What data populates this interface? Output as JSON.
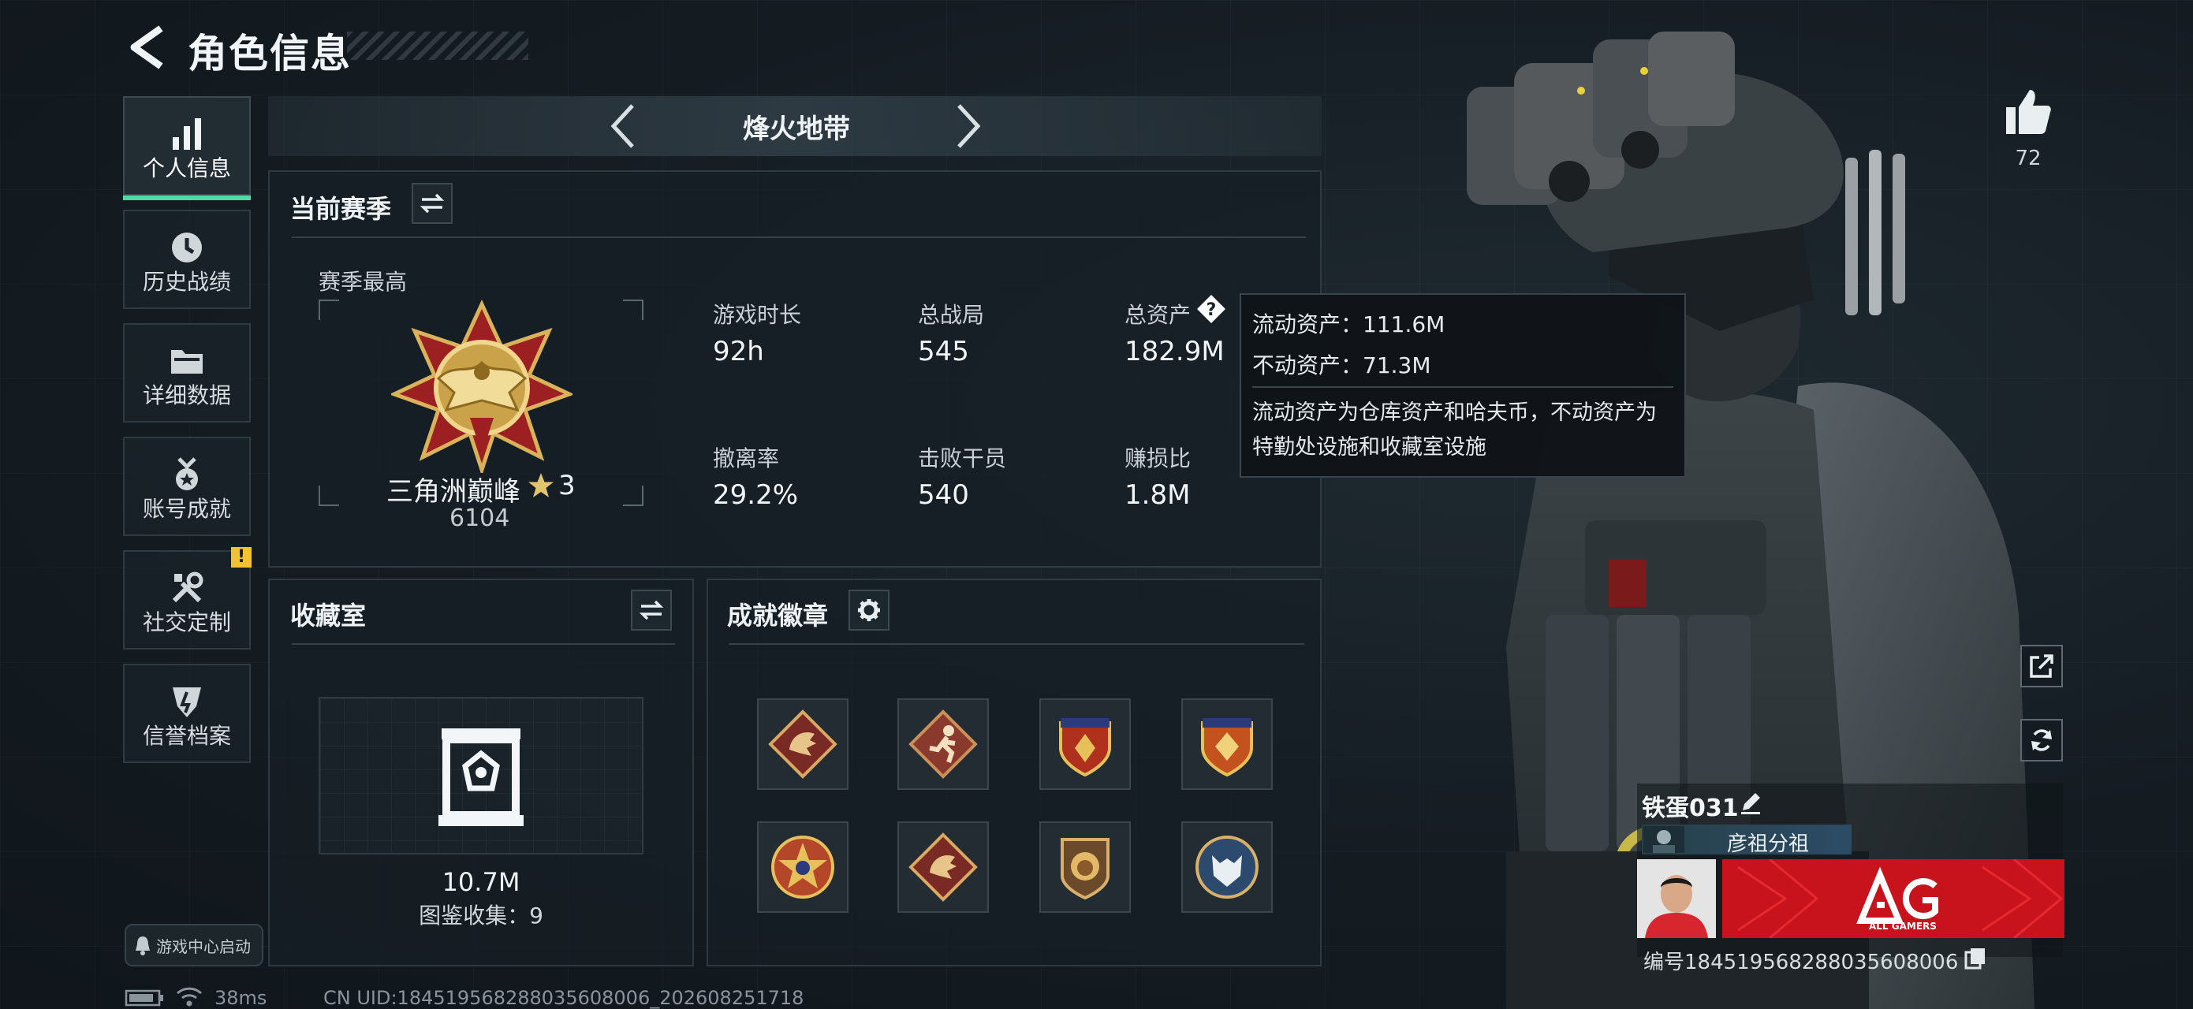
{
  "header": {
    "title": "角色信息"
  },
  "sidebar": {
    "items": [
      {
        "label": "个人信息",
        "icon": "chart-bars-icon",
        "active": true
      },
      {
        "label": "历史战绩",
        "icon": "clock-icon"
      },
      {
        "label": "详细数据",
        "icon": "folder-icon"
      },
      {
        "label": "账号成就",
        "icon": "medal-icon"
      },
      {
        "label": "社交定制",
        "icon": "tools-icon",
        "badge": "!"
      },
      {
        "label": "信誉档案",
        "icon": "shield-icon"
      }
    ],
    "launch_label": "游戏中心启动"
  },
  "mode": {
    "label": "烽火地带"
  },
  "season": {
    "title": "当前赛季",
    "best_label": "赛季最高",
    "rank_name": "三角洲巅峰",
    "rank_stars": "3",
    "rank_score": "6104",
    "stats": [
      {
        "label": "游戏时长",
        "value": "92h"
      },
      {
        "label": "总战局",
        "value": "545"
      },
      {
        "label": "总资产",
        "value": "182.9M"
      },
      {
        "label": "撤离率",
        "value": "29.2%"
      },
      {
        "label": "击败干员",
        "value": "540"
      },
      {
        "label": "赚损比",
        "value": "1.8M"
      }
    ],
    "help_glyph": "?"
  },
  "tooltip": {
    "liquid": "流动资产：111.6M",
    "fixed": "不动资产：71.3M",
    "description": "流动资产为仓库资产和哈夫币，不动资产为特勤处设施和收藏室设施"
  },
  "collection": {
    "title": "收藏室",
    "value": "10.7M",
    "count_label": "图鉴收集：9"
  },
  "achievements": {
    "title": "成就徽章",
    "badges": [
      "dragon-badge-icon",
      "runner-badge-icon",
      "shield-badge-icon",
      "shield-badge-icon",
      "star-badge-icon",
      "dragon-badge-icon",
      "lion-badge-icon",
      "wolf-badge-icon"
    ]
  },
  "profile": {
    "likes": "72",
    "player_name": "铁蛋031",
    "team_name": "彦祖分祖",
    "team_logo_text": "AG",
    "team_logo_sub": "ALL GAMERS",
    "player_id": "编号184519568288035608006"
  },
  "status_bar": {
    "ping": "38ms",
    "uid": "CN UID:184519568288035608006_202608251718"
  },
  "colors": {
    "accent": "#4fd9a6",
    "warning": "#f2c230",
    "background": "#141c22",
    "team_red": "#d6141e"
  }
}
